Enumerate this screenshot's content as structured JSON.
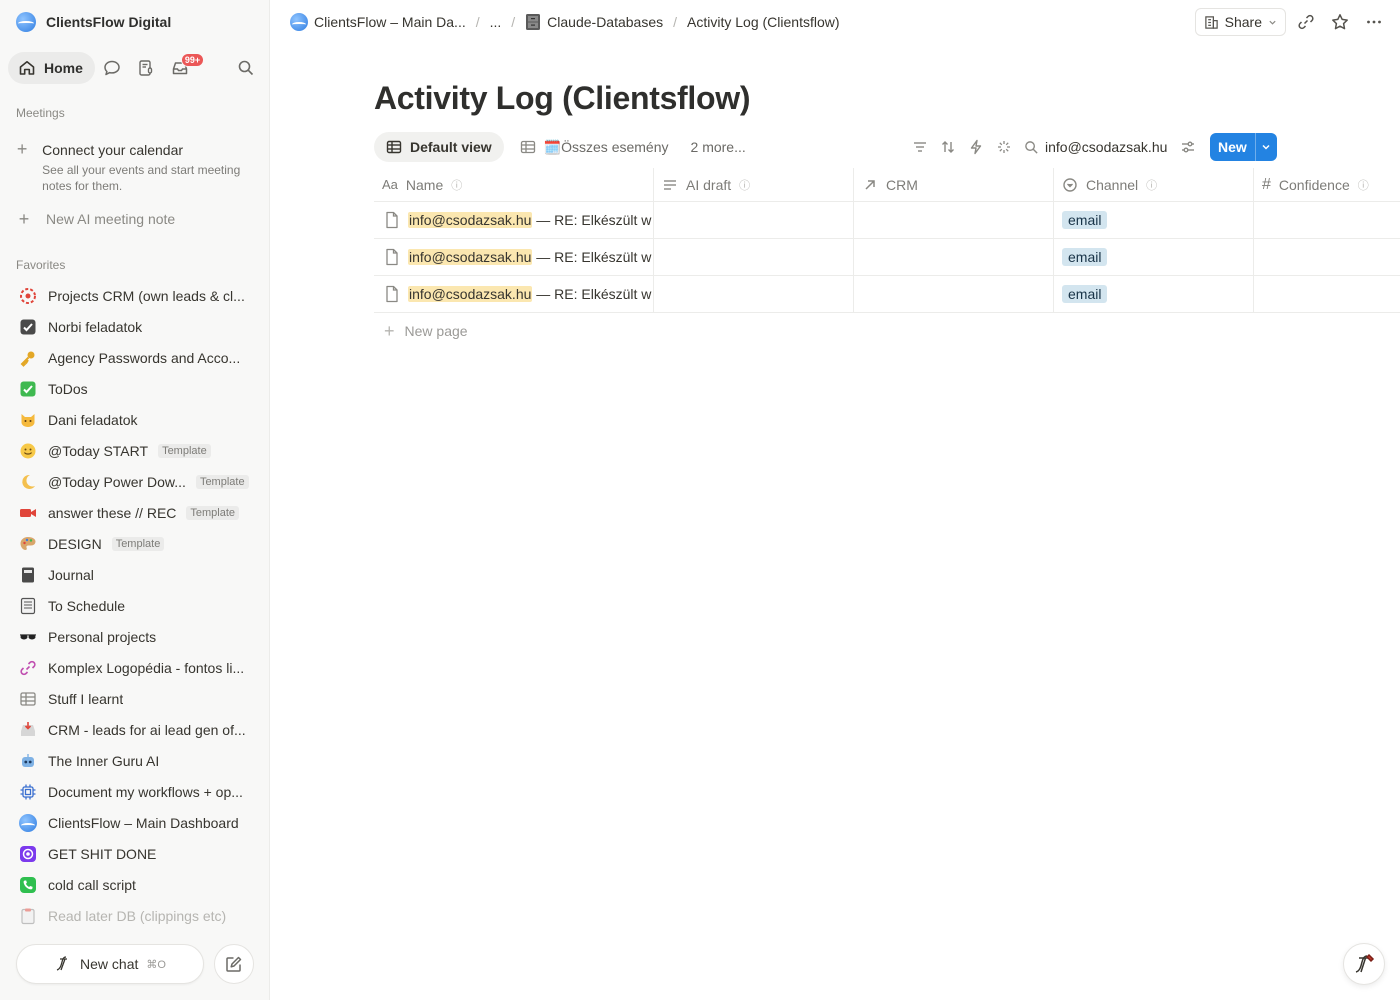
{
  "sidebar": {
    "workspace": "ClientsFlow Digital",
    "home_label": "Home",
    "inbox_badge": "99+",
    "meetings_label": "Meetings",
    "calendar_title": "Connect your calendar",
    "calendar_sub": "See all your events and start meeting notes for them.",
    "new_ai_note": "New AI meeting note",
    "favorites_label": "Favorites",
    "favorites": [
      {
        "label": "Projects CRM (own leads & cl...",
        "icon": "target-icon"
      },
      {
        "label": "Norbi feladatok",
        "icon": "checkbox-icon"
      },
      {
        "label": "Agency Passwords and Acco...",
        "icon": "key-icon"
      },
      {
        "label": "ToDos",
        "icon": "check-mark-icon"
      },
      {
        "label": "Dani feladatok",
        "icon": "cat-face-icon"
      },
      {
        "label": "@Today START",
        "icon": "smiley-icon",
        "tag": "Template"
      },
      {
        "label": "@Today Power Dow...",
        "icon": "moon-icon",
        "tag": "Template"
      },
      {
        "label": "answer these // REC",
        "icon": "video-camera-icon",
        "tag": "Template"
      },
      {
        "label": "DESIGN",
        "icon": "palette-icon",
        "tag": "Template"
      },
      {
        "label": "Journal",
        "icon": "notebook-icon"
      },
      {
        "label": "To Schedule",
        "icon": "ledger-icon"
      },
      {
        "label": "Personal projects",
        "icon": "sunglasses-icon"
      },
      {
        "label": "Komplex Logopédia - fontos li...",
        "icon": "link-icon"
      },
      {
        "label": "Stuff I learnt",
        "icon": "table-icon"
      },
      {
        "label": "CRM - leads for ai lead gen of...",
        "icon": "inbox-tray-icon"
      },
      {
        "label": "The Inner Guru AI",
        "icon": "robot-icon"
      },
      {
        "label": "Document my workflows + op...",
        "icon": "chip-icon"
      },
      {
        "label": "ClientsFlow – Main Dashboard",
        "icon": "clientsflow-logo-icon"
      },
      {
        "label": "GET SHIT DONE",
        "icon": "focus-icon"
      },
      {
        "label": "cold call script",
        "icon": "phone-icon"
      },
      {
        "label": "Read later DB (clippings etc)",
        "icon": "clipboard-icon"
      }
    ],
    "new_chat": "New chat",
    "new_chat_kbd": "⌘O"
  },
  "topbar": {
    "crumb1": "ClientsFlow – Main Da...",
    "crumb2": "...",
    "crumb3": "Claude-Databases",
    "crumb4": "Activity Log (Clientsflow)",
    "share": "Share"
  },
  "page": {
    "title": "Activity Log (Clientsflow)",
    "views": {
      "active": "Default view",
      "second": "🗓️Összes esemény",
      "more": "2 more..."
    },
    "search_value": "info@csodazsak.hu",
    "new_label": "New"
  },
  "table": {
    "columns": [
      {
        "label": "Name",
        "icon": "Aa"
      },
      {
        "label": "AI draft",
        "icon": "text-icon"
      },
      {
        "label": "CRM",
        "icon": "relation-arrow-icon"
      },
      {
        "label": "Channel",
        "icon": "select-icon"
      },
      {
        "label": "Confidence",
        "icon": "#"
      }
    ],
    "rows": [
      {
        "sender": "info@csodazsak.hu",
        "subject": " — RE: Elkészült w",
        "channel": "email"
      },
      {
        "sender": "info@csodazsak.hu",
        "subject": " — RE: Elkészült w",
        "channel": "email"
      },
      {
        "sender": "info@csodazsak.hu",
        "subject": " — RE: Elkészült w",
        "channel": "email"
      }
    ],
    "new_page": "New page"
  }
}
